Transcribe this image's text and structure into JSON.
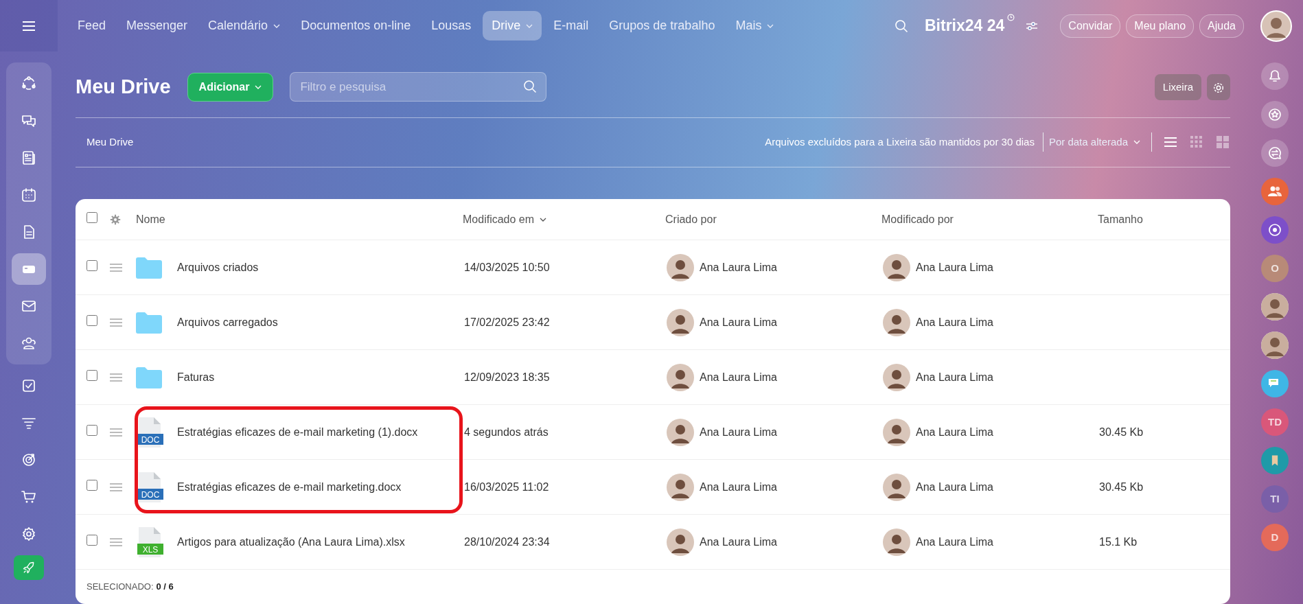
{
  "top_nav": {
    "items": [
      {
        "label": "Feed",
        "dropdown": false,
        "selected": false
      },
      {
        "label": "Messenger",
        "dropdown": false,
        "selected": false
      },
      {
        "label": "Calendário",
        "dropdown": true,
        "selected": false
      },
      {
        "label": "Documentos on-line",
        "dropdown": false,
        "selected": false
      },
      {
        "label": "Lousas",
        "dropdown": false,
        "selected": false
      },
      {
        "label": "Drive",
        "dropdown": true,
        "selected": true
      },
      {
        "label": "E-mail",
        "dropdown": false,
        "selected": false
      },
      {
        "label": "Grupos de trabalho",
        "dropdown": false,
        "selected": false
      },
      {
        "label": "Mais",
        "dropdown": true,
        "selected": false
      }
    ],
    "logo": {
      "name": "Bitrix24",
      "suffix": "24"
    },
    "buttons": [
      "Convidar",
      "Meu plano",
      "Ajuda"
    ]
  },
  "left_sidebar": {
    "items": [
      {
        "selected": false
      },
      {
        "selected": false
      },
      {
        "selected": false
      },
      {
        "selected": false
      },
      {
        "selected": false
      },
      {
        "selected": true
      },
      {
        "selected": false
      },
      {
        "selected": false
      },
      {
        "selected": false
      },
      {
        "selected": false
      },
      {
        "selected": false
      },
      {
        "selected": false
      },
      {
        "selected": false
      }
    ]
  },
  "right_sidebar": {
    "items": [
      {
        "kind": "icon"
      },
      {
        "kind": "icon"
      },
      {
        "kind": "icon"
      },
      {
        "kind": "group",
        "color": "#e8643c"
      },
      {
        "kind": "icon-round",
        "color": "#7d4fc9"
      },
      {
        "kind": "initials",
        "text": "O",
        "color": "#b88a78"
      },
      {
        "kind": "avatar"
      },
      {
        "kind": "avatar"
      },
      {
        "kind": "chat",
        "color": "#3fb6e6"
      },
      {
        "kind": "initials",
        "text": "TD",
        "color": "#d9577a"
      },
      {
        "kind": "bookmark",
        "color": "#1f9aa8"
      },
      {
        "kind": "initials",
        "text": "TI",
        "color": "#7a5fa8"
      },
      {
        "kind": "initials",
        "text": "D",
        "color": "#e46a5a"
      }
    ]
  },
  "header": {
    "title": "Meu Drive",
    "add_button": "Adicionar",
    "search": {
      "placeholder": "Filtro e pesquisa"
    },
    "trash_button": "Lixeira"
  },
  "toolbar": {
    "breadcrumb": "Meu Drive",
    "notice": "Arquivos excluídos para a Lixeira são mantidos por 30 dias",
    "sort": "Por data alterada",
    "views": [
      {
        "selected": true
      },
      {
        "selected": false
      },
      {
        "selected": false
      }
    ]
  },
  "table": {
    "select_all": {
      "checked": false
    },
    "columns": [
      {
        "label": "Nome",
        "sorted": false
      },
      {
        "label": "Modificado em",
        "sorted": true
      },
      {
        "label": "Criado por",
        "sorted": false
      },
      {
        "label": "Modificado por",
        "sorted": false
      },
      {
        "label": "Tamanho",
        "sorted": false
      }
    ],
    "rows": [
      {
        "checked": false,
        "kind": "folder",
        "name": "Arquivos criados",
        "modified": "14/03/2025 10:50",
        "created_by": "Ana Laura Lima",
        "modified_by": "Ana Laura Lima",
        "highlighted": false
      },
      {
        "checked": false,
        "kind": "folder",
        "name": "Arquivos carregados",
        "modified": "17/02/2025 23:42",
        "created_by": "Ana Laura Lima",
        "modified_by": "Ana Laura Lima",
        "highlighted": false
      },
      {
        "checked": false,
        "kind": "folder",
        "name": "Faturas",
        "modified": "12/09/2023 18:35",
        "created_by": "Ana Laura Lima",
        "modified_by": "Ana Laura Lima",
        "highlighted": false
      },
      {
        "checked": false,
        "kind": "file",
        "badge": "DOC",
        "color": "#2a6fb8",
        "name": "Estratégias eficazes de e-mail marketing (1).docx",
        "modified": "4 segundos atrás",
        "created_by": "Ana Laura Lima",
        "modified_by": "Ana Laura Lima",
        "size": "30.45 Kb",
        "highlighted": true
      },
      {
        "checked": false,
        "kind": "file",
        "badge": "DOC",
        "color": "#2a6fb8",
        "name": "Estratégias eficazes de e-mail marketing.docx",
        "modified": "16/03/2025 11:02",
        "created_by": "Ana Laura Lima",
        "modified_by": "Ana Laura Lima",
        "size": "30.45 Kb",
        "highlighted": true
      },
      {
        "checked": false,
        "kind": "file",
        "badge": "XLS",
        "color": "#3fb02f",
        "name": "Artigos para atualização (Ana Laura Lima).xlsx",
        "modified": "28/10/2024 23:34",
        "created_by": "Ana Laura Lima",
        "modified_by": "Ana Laura Lima",
        "size": "15.1 Kb",
        "highlighted": false
      }
    ]
  },
  "footer": {
    "label": "SELECIONADO:",
    "count": "0 / 6"
  }
}
